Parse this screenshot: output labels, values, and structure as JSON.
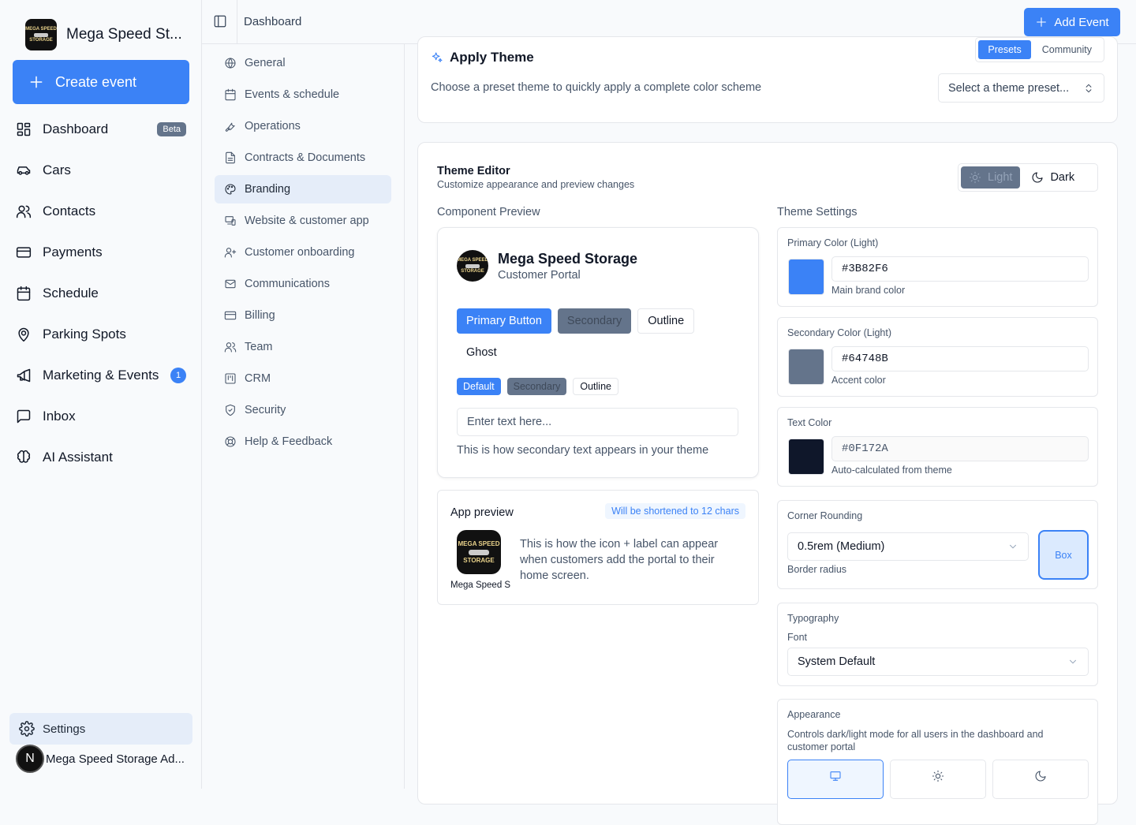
{
  "brand": {
    "name": "Mega Speed St...",
    "logo_text": [
      "MEGA SPEED",
      "STORAGE"
    ]
  },
  "sidebar": {
    "create_label": "Create event",
    "items": [
      {
        "label": "Dashboard",
        "icon": "grid-icon",
        "badge": "Beta"
      },
      {
        "label": "Cars",
        "icon": "car-icon"
      },
      {
        "label": "Contacts",
        "icon": "users-icon"
      },
      {
        "label": "Payments",
        "icon": "credit-card-icon"
      },
      {
        "label": "Schedule",
        "icon": "calendar-icon"
      },
      {
        "label": "Parking Spots",
        "icon": "map-pin-icon"
      },
      {
        "label": "Marketing & Events",
        "icon": "megaphone-icon",
        "count": "1"
      },
      {
        "label": "Inbox",
        "icon": "message-square-icon"
      },
      {
        "label": "AI Assistant",
        "icon": "brain-icon"
      }
    ],
    "settings_label": "Settings",
    "user": {
      "initial": "N",
      "name": "Mega Speed Storage Ad..."
    }
  },
  "topbar": {
    "breadcrumb": "Dashboard",
    "add_event_label": "Add Event"
  },
  "settings_nav": [
    {
      "label": "General",
      "icon": "globe-icon"
    },
    {
      "label": "Events & schedule",
      "icon": "calendar-icon"
    },
    {
      "label": "Operations",
      "icon": "wrench-icon"
    },
    {
      "label": "Contracts & Documents",
      "icon": "file-icon"
    },
    {
      "label": "Branding",
      "icon": "palette-icon",
      "active": true
    },
    {
      "label": "Website & customer app",
      "icon": "devices-icon"
    },
    {
      "label": "Customer onboarding",
      "icon": "user-plus-icon"
    },
    {
      "label": "Communications",
      "icon": "mail-icon"
    },
    {
      "label": "Billing",
      "icon": "credit-card-icon"
    },
    {
      "label": "Team",
      "icon": "users-icon"
    },
    {
      "label": "CRM",
      "icon": "kanban-icon"
    },
    {
      "label": "Security",
      "icon": "shield-icon"
    },
    {
      "label": "Help & Feedback",
      "icon": "life-buoy-icon"
    }
  ],
  "apply_theme": {
    "title": "Apply Theme",
    "tabs": [
      "Presets",
      "Community"
    ],
    "active_tab": "Presets",
    "description": "Choose a preset theme to quickly apply a complete color scheme",
    "select_placeholder": "Select a theme preset..."
  },
  "theme_editor": {
    "title": "Theme Editor",
    "subtitle": "Customize appearance and preview changes",
    "modes": [
      "Light",
      "Dark"
    ],
    "active_mode": "Light",
    "component_preview_label": "Component Preview",
    "theme_settings_label": "Theme Settings"
  },
  "preview": {
    "name": "Mega Speed Storage",
    "portal": "Customer Portal",
    "buttons": [
      "Primary Button",
      "Secondary",
      "Outline",
      "Ghost"
    ],
    "badges": [
      "Default",
      "Secondary",
      "Outline"
    ],
    "input_placeholder": "Enter text here...",
    "secondary_text": "This is how secondary text appears in your theme"
  },
  "app_preview": {
    "title": "App preview",
    "pill": "Will be shortened to 12 chars",
    "icon_label": "Mega Speed S",
    "description": "This is how the icon + label can appear when customers add the portal to their home screen."
  },
  "settings": {
    "primary": {
      "label": "Primary Color (Light)",
      "value": "#3B82F6",
      "help": "Main brand color"
    },
    "secondary": {
      "label": "Secondary Color (Light)",
      "value": "#64748B",
      "help": "Accent color"
    },
    "text": {
      "label": "Text Color",
      "value": "#0F172A",
      "help": "Auto-calculated from theme"
    },
    "rounding": {
      "label": "Corner Rounding",
      "value": "0.5rem (Medium)",
      "help": "Border radius",
      "box_label": "Box"
    },
    "typography": {
      "label": "Typography",
      "font_label": "Font",
      "value": "System Default"
    },
    "appearance": {
      "label": "Appearance",
      "description": "Controls dark/light mode for all users in the dashboard and customer portal",
      "options": [
        "monitor-icon",
        "sun-icon",
        "moon-icon"
      ],
      "active": "monitor-icon"
    }
  },
  "colors": {
    "accent": "#3b82f6",
    "secondary": "#64748b",
    "text": "#0f172a"
  }
}
